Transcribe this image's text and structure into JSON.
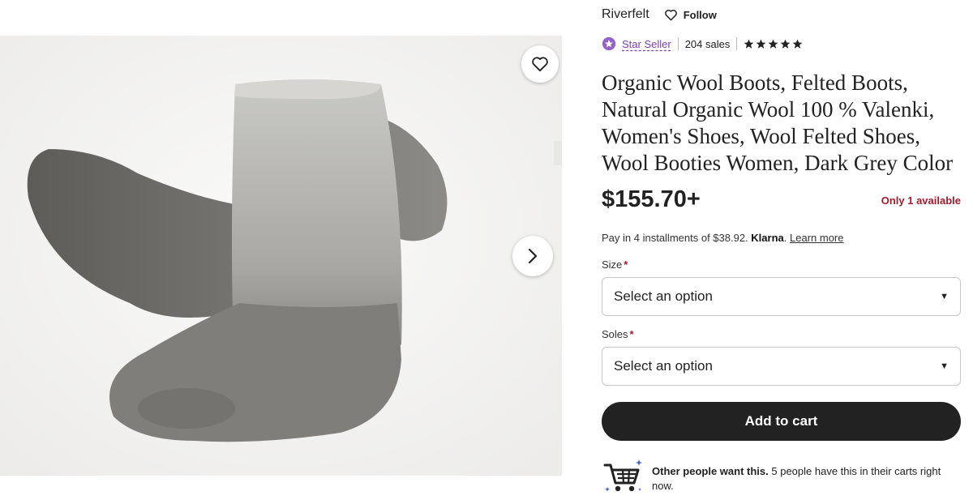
{
  "shop": {
    "name": "Riverfelt",
    "follow_label": "Follow"
  },
  "badges": {
    "star_seller": "Star Seller",
    "sales": "204 sales",
    "rating_stars": 5,
    "star_color": "#222222",
    "star_seller_color": "#7a3fb3"
  },
  "product": {
    "title": "Organic Wool Boots, Felted Boots, Natural Organic Wool 100 % Valenki, Women's Shoes, Wool Felted Shoes, Wool Booties Women, Dark Grey Color",
    "price": "$155.70+",
    "availability": "Only 1 available"
  },
  "installments": {
    "text": "Pay in 4 installments of $38.92.",
    "provider": "Klarna",
    "separator": ".",
    "learn_more": "Learn more"
  },
  "options": [
    {
      "label": "Size",
      "required_mark": "*",
      "value": "Select an option"
    },
    {
      "label": "Soles",
      "required_mark": "*",
      "value": "Select an option"
    }
  ],
  "cart": {
    "add_label": "Add to cart"
  },
  "demand": {
    "bold": "Other people want this.",
    "text": "5 people have this in their carts right now."
  },
  "colors": {
    "accent_red": "#a61a2e",
    "button_dark": "#222222"
  },
  "icons": {
    "favorite": "heart-icon",
    "next": "chevron-right-icon",
    "follow": "heart-icon",
    "cart": "shopping-cart-icon"
  }
}
